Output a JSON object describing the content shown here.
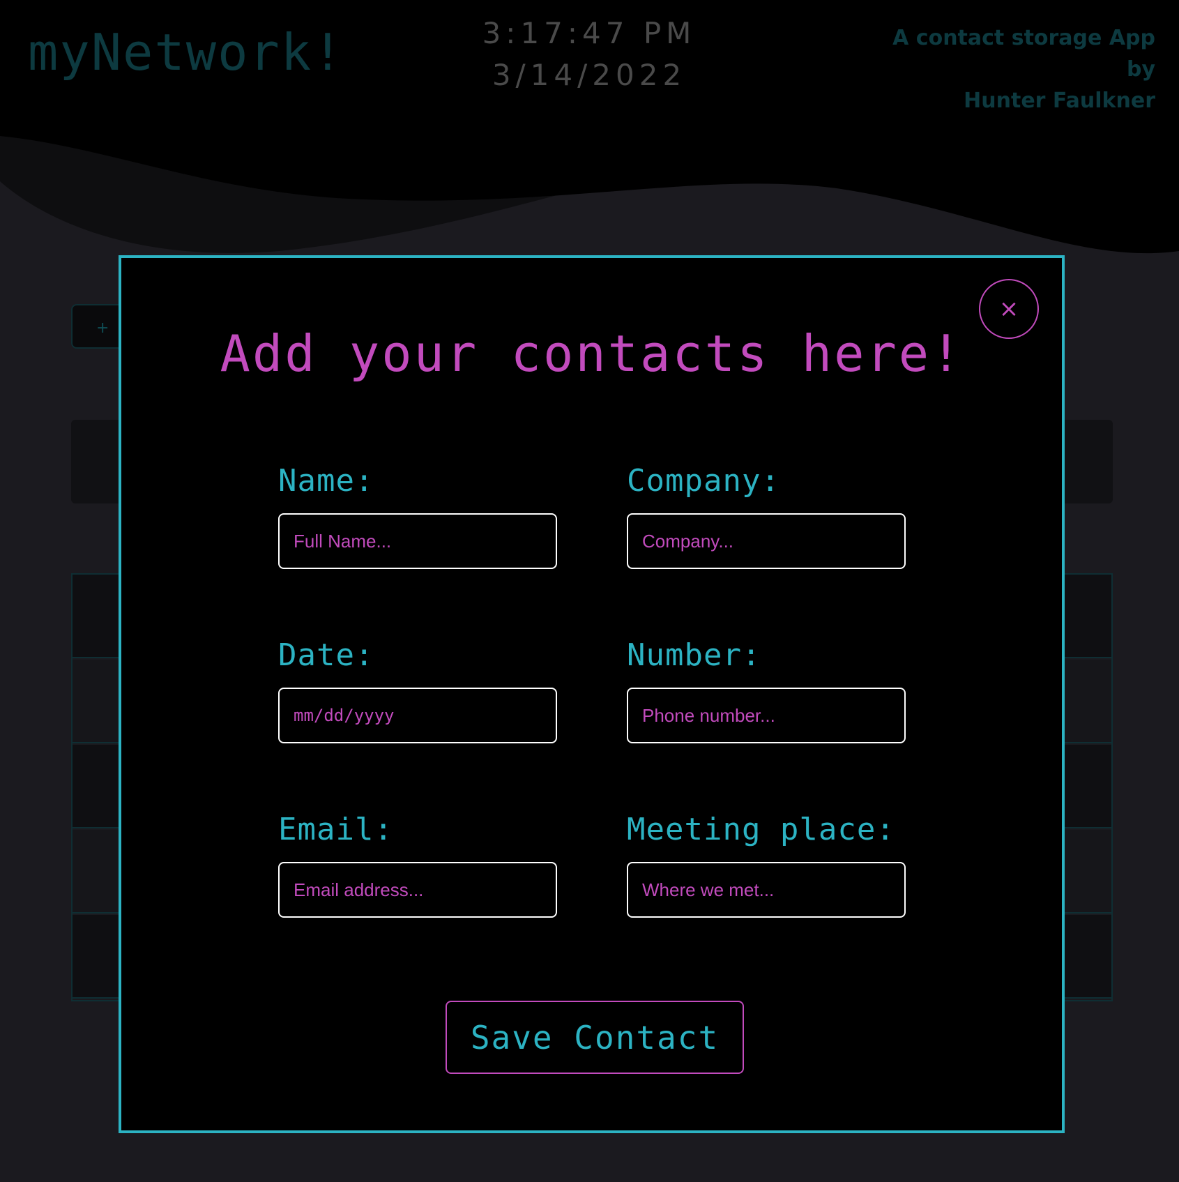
{
  "header": {
    "logo": "myNetwork!",
    "time": "3:17:47 PM",
    "date": "3/14/2022",
    "byline_line1": "A contact storage App by",
    "byline_line2": "Hunter Faulkner"
  },
  "background": {
    "add_button_label": "+"
  },
  "modal": {
    "title": "Add your contacts here!",
    "close_label": "×",
    "fields": {
      "name": {
        "label": "Name:",
        "placeholder": "Full Name..."
      },
      "company": {
        "label": "Company:",
        "placeholder": "Company..."
      },
      "date": {
        "label": "Date:",
        "placeholder": "mm/dd/yyyy"
      },
      "number": {
        "label": "Number:",
        "placeholder": "Phone number..."
      },
      "email": {
        "label": "Email:",
        "placeholder": "Email address..."
      },
      "meeting_place": {
        "label": "Meeting place:",
        "placeholder": "Where we met..."
      }
    },
    "save_label": "Save Contact"
  },
  "colors": {
    "accent_cyan": "#2cb3c3",
    "accent_magenta": "#c24bbd",
    "background": "#1b1a1f",
    "header_text": "#0d3a40"
  }
}
